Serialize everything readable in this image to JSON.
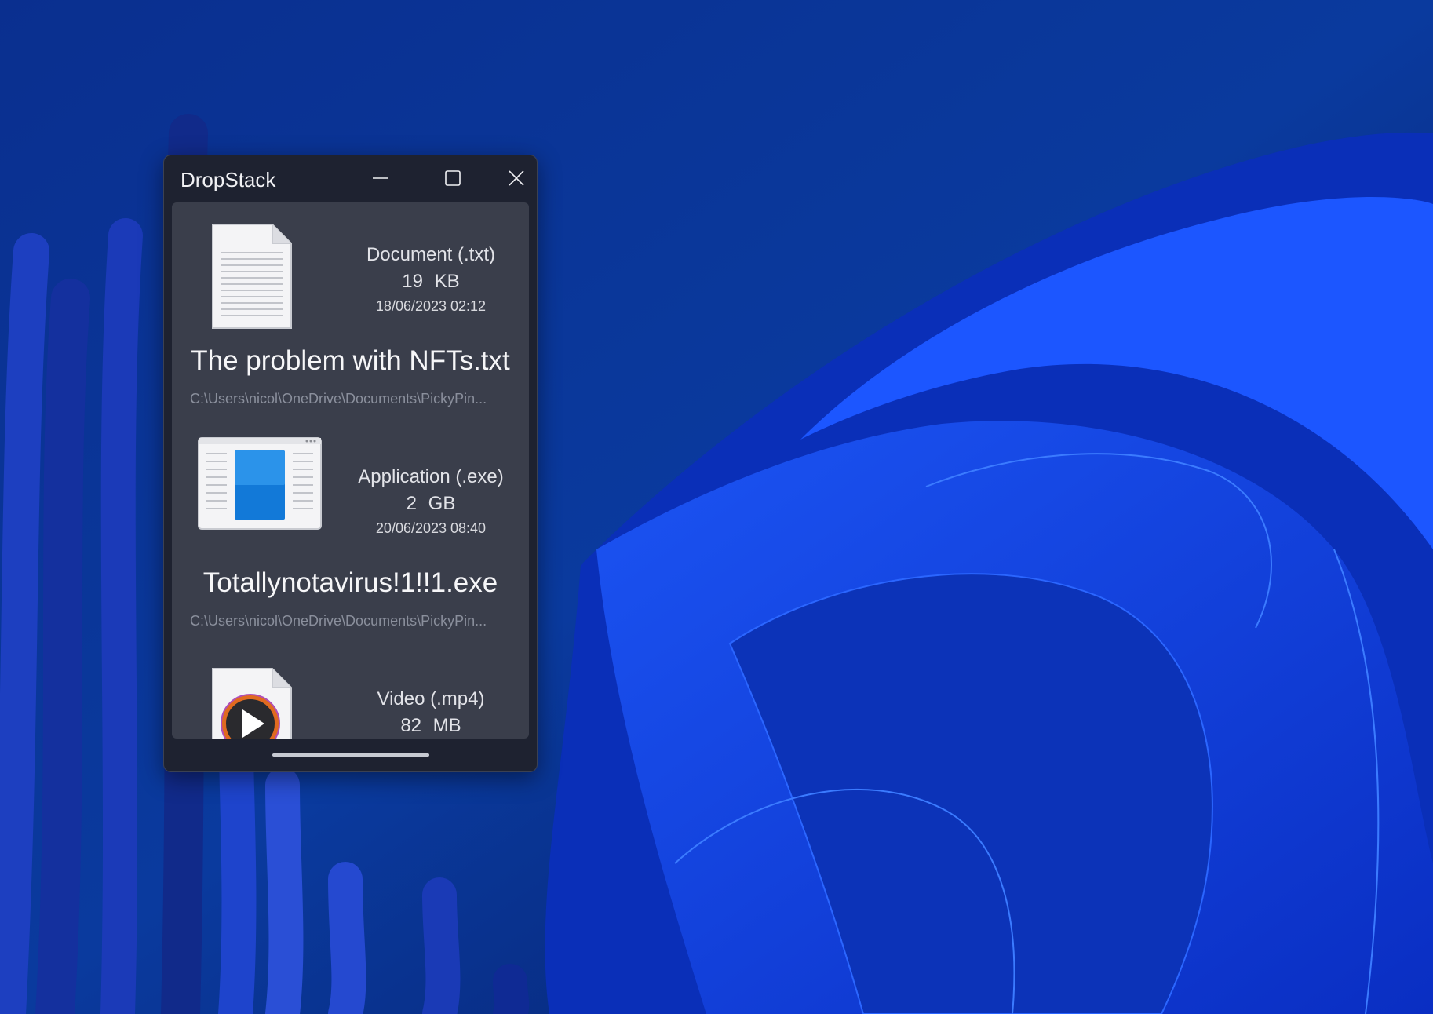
{
  "accent": "#0a4fe0",
  "window": {
    "title": "DropStack",
    "controls": {
      "minimize_icon": "minimize-icon",
      "maximize_icon": "maximize-icon",
      "close_icon": "close-icon"
    }
  },
  "files": [
    {
      "icon": "text-document-icon",
      "type": "Document (.txt)",
      "size": "19 KB",
      "date": "18/06/2023 02:12",
      "name": "The problem with NFTs.txt",
      "path": "C:\\Users\\nicol\\OneDrive\\Documents\\PickyPin..."
    },
    {
      "icon": "application-window-icon",
      "type": "Application (.exe)",
      "size": "2 GB",
      "date": "20/06/2023 08:40",
      "name": "Totallynotavirus!1!!1.exe",
      "path": "C:\\Users\\nicol\\OneDrive\\Documents\\PickyPin..."
    },
    {
      "icon": "video-file-icon",
      "type": "Video (.mp4)",
      "size": "82 MB"
    }
  ]
}
